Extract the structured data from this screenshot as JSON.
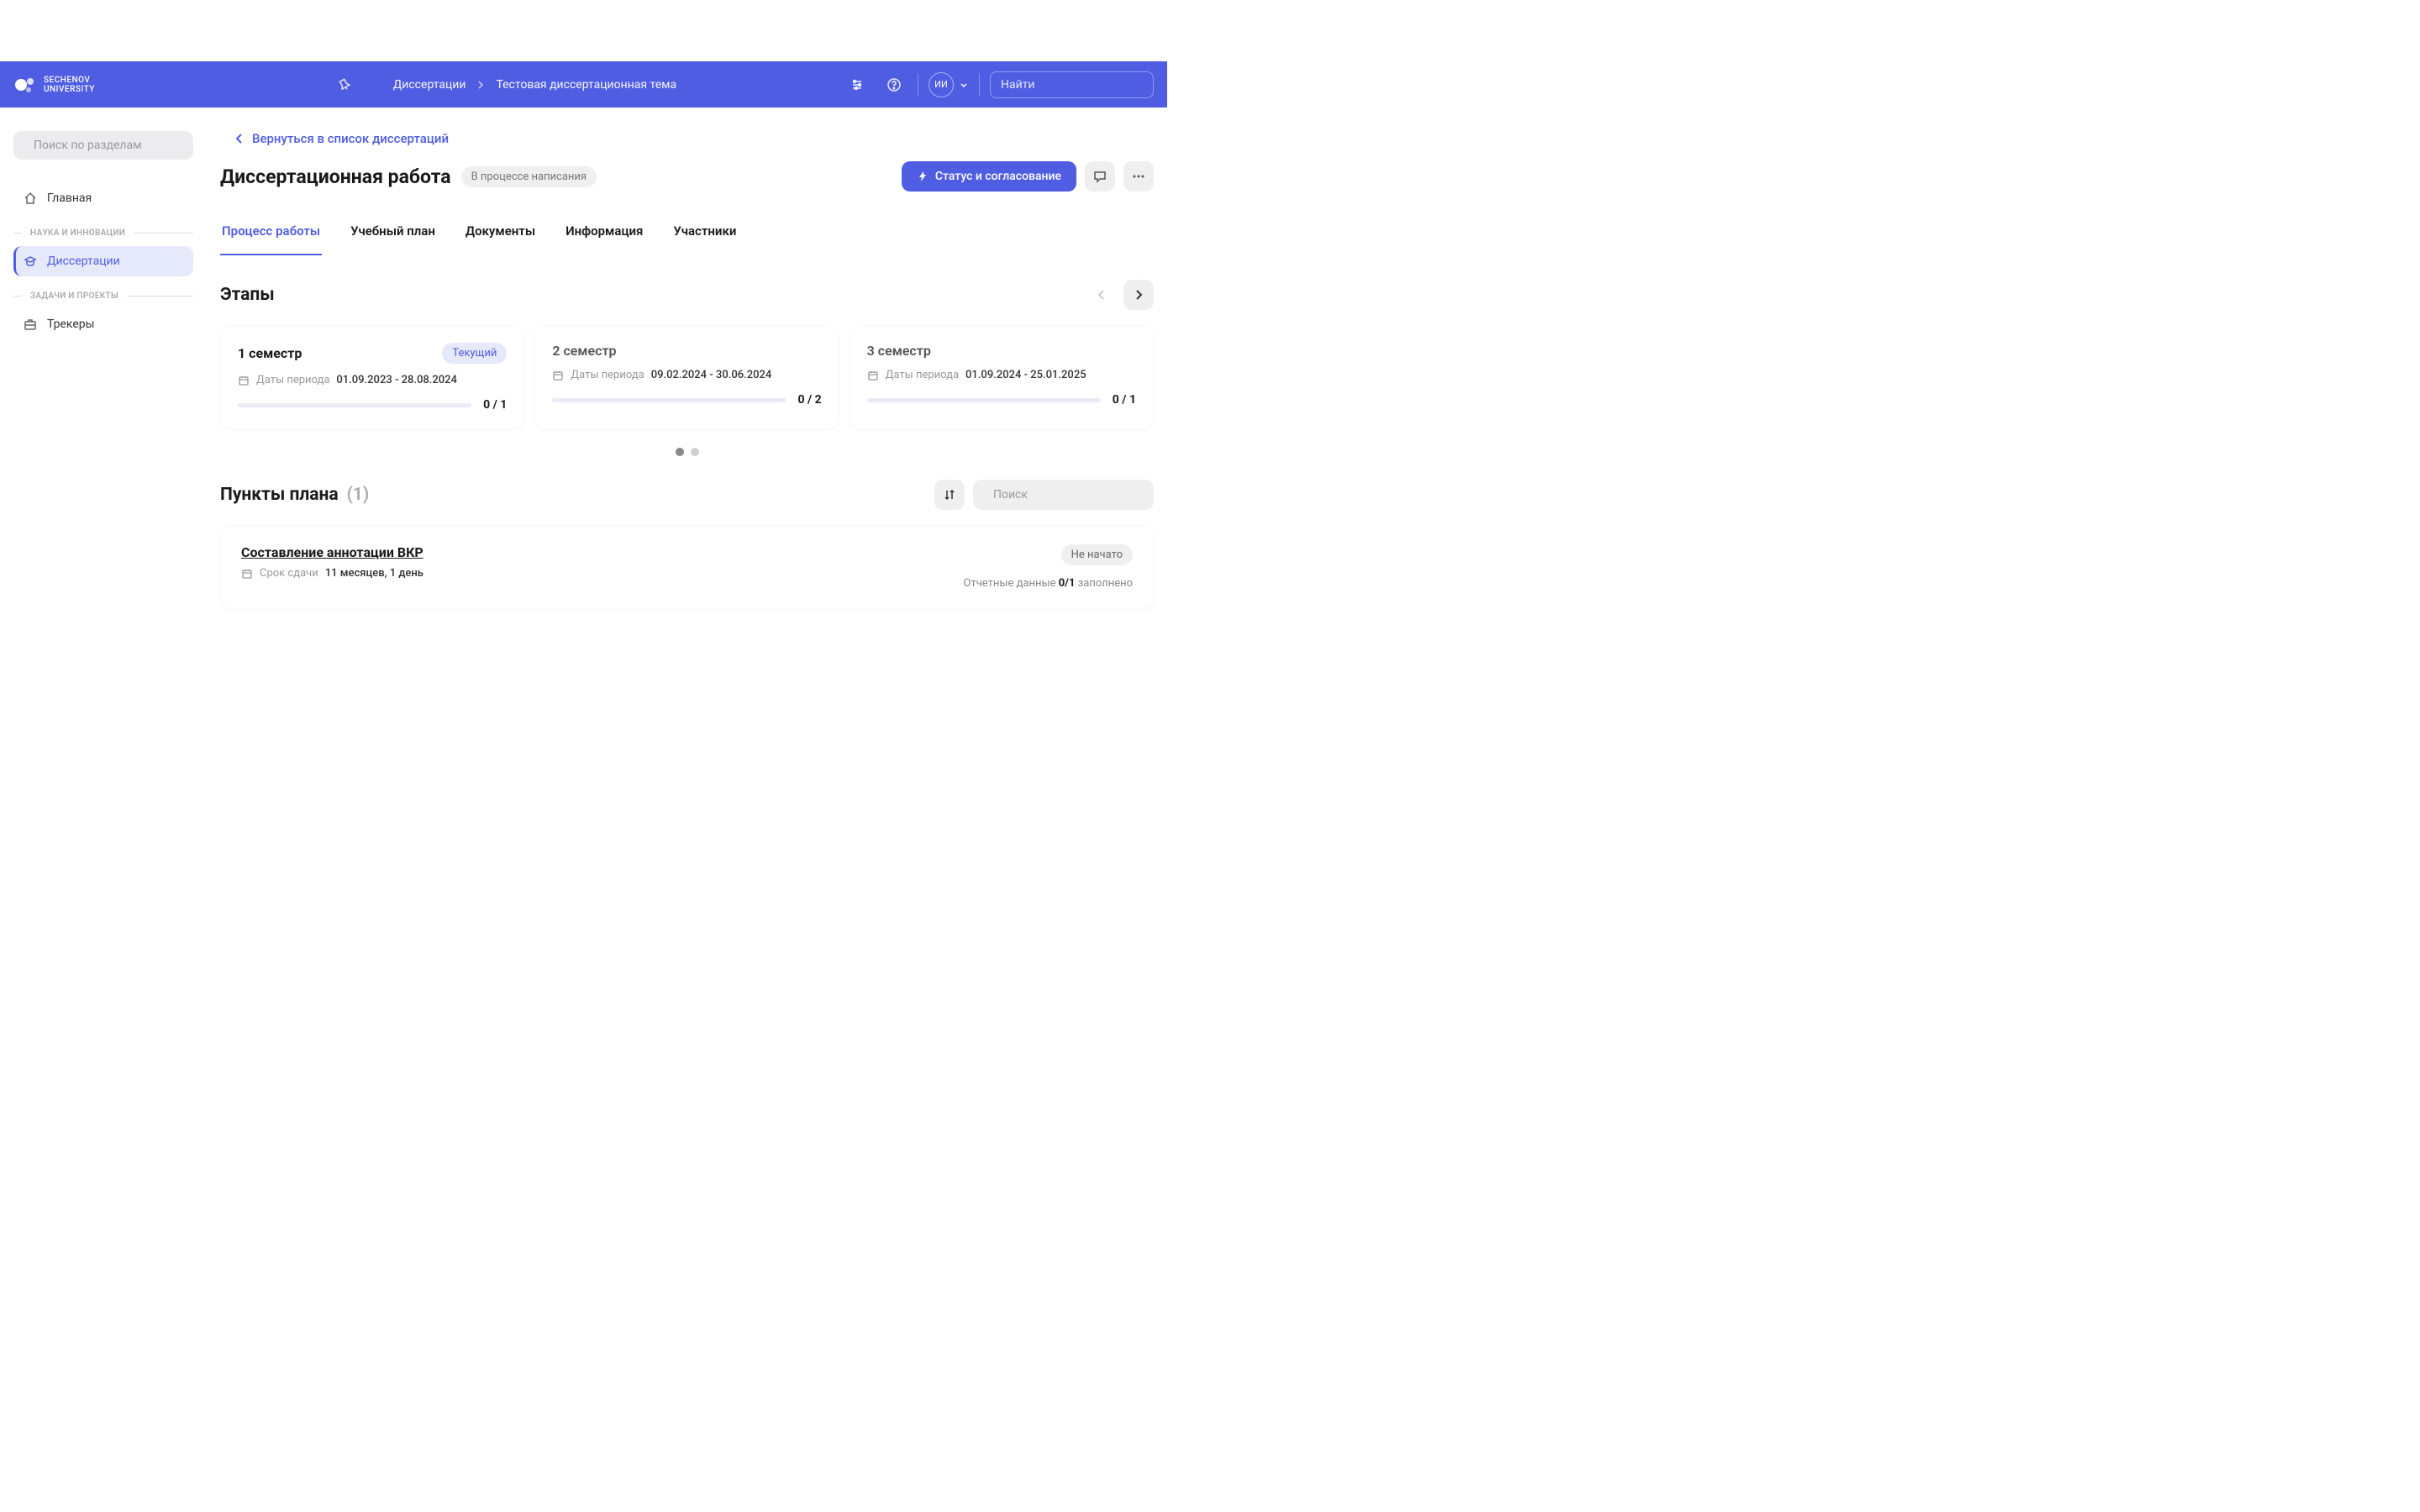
{
  "logo": {
    "line1": "SECHENOV",
    "line2": "UNIVERSITY"
  },
  "breadcrumb": {
    "root": "Диссертации",
    "current": "Тестовая диссертационная тема"
  },
  "user_initials": "ИИ",
  "top_search_placeholder": "Найти",
  "sidebar": {
    "search_placeholder": "Поиск по разделам",
    "home": "Главная",
    "section1": "НАУКА И ИННОВАЦИИ",
    "dissertations": "Диссертации",
    "section2": "ЗАДАЧИ И ПРОЕКТЫ",
    "trackers": "Трекеры"
  },
  "back_label": "Вернуться в список диссертаций",
  "page_title": "Диссертационная работа",
  "page_status": "В процессе написания",
  "primary_action": "Статус и согласование",
  "tabs": {
    "t1": "Процесс работы",
    "t2": "Учебный план",
    "t3": "Документы",
    "t4": "Информация",
    "t5": "Участники"
  },
  "stages_title": "Этапы",
  "stages": [
    {
      "title": "1 семестр",
      "current": "Текущий",
      "dates_label": "Даты периода",
      "dates": "01.09.2023 - 28.08.2024",
      "progress": "0 / 1"
    },
    {
      "title": "2 семестр",
      "dates_label": "Даты периода",
      "dates": "09.02.2024 - 30.06.2024",
      "progress": "0 / 2"
    },
    {
      "title": "3 семестр",
      "dates_label": "Даты периода",
      "dates": "01.09.2024 - 25.01.2025",
      "progress": "0 / 1"
    }
  ],
  "plan": {
    "title": "Пункты плана",
    "count": "(1)",
    "search_placeholder": "Поиск"
  },
  "plan_item": {
    "title": "Составление аннотации ВКР",
    "due_label": "Срок сдачи",
    "due_value": "11 месяцев, 1 день",
    "status": "Не начато",
    "report_label": "Отчетные данные",
    "report_value": "0/1",
    "report_suffix": "заполнено"
  }
}
